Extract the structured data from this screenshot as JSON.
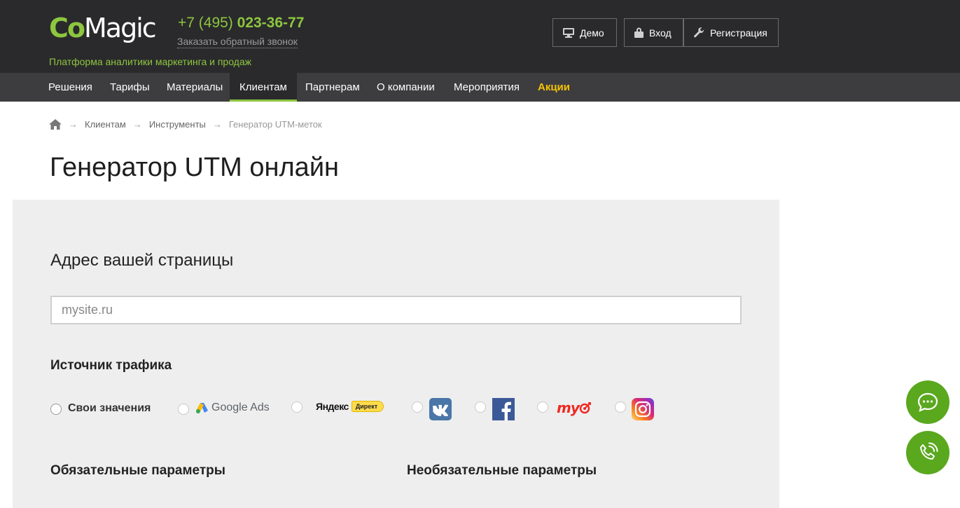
{
  "header": {
    "logo_co": "Co",
    "logo_magic": "Magic",
    "tagline": "Платформа аналитики маркетинга и продаж",
    "phone_prefix": "+7 (495) ",
    "phone_number": "023-36-77",
    "callback": "Заказать обратный звонок",
    "demo_label": "Демо",
    "login_label": "Вход",
    "register_label": "Регистрация"
  },
  "nav": {
    "items": [
      {
        "label": "Решения"
      },
      {
        "label": "Тарифы"
      },
      {
        "label": "Материалы"
      },
      {
        "label": "Клиентам",
        "active": true
      },
      {
        "label": "Партнерам"
      },
      {
        "label": "О компании"
      },
      {
        "label": "Мероприятия"
      },
      {
        "label": "Акции",
        "promo": true
      }
    ]
  },
  "breadcrumb": {
    "items": [
      "Клиентам",
      "Инструменты",
      "Генератор UTM-меток"
    ],
    "separator": "→"
  },
  "page": {
    "title": "Генератор UTM онлайн"
  },
  "form": {
    "url_section_label": "Адрес вашей страницы",
    "url_placeholder": "mysite.ru",
    "url_value": "",
    "traffic_source_label": "Источник трафика",
    "sources": [
      {
        "label": "Свои значения",
        "icon": "radio-text"
      },
      {
        "label": "Google Ads",
        "icon": "google-ads-logo"
      },
      {
        "label": "Яндекс Директ",
        "icon": "yandex-direct-logo",
        "badge": "Директ",
        "wordmark": "Яндекс"
      },
      {
        "label": "VK",
        "icon": "vk-logo"
      },
      {
        "label": "Facebook",
        "icon": "facebook-logo"
      },
      {
        "label": "myTarget",
        "icon": "mytarget-logo"
      },
      {
        "label": "Instagram",
        "icon": "instagram-logo"
      }
    ],
    "required_params_label": "Обязательные параметры",
    "optional_params_label": "Необязательные параметры"
  },
  "colors": {
    "brand_green": "#8dc63f",
    "header_bg": "#2a2a2c",
    "nav_bg": "#3d3d3f",
    "promo_yellow": "#f5c400",
    "panel_bg": "#eeeeee",
    "fab_green": "#5aa81e"
  }
}
